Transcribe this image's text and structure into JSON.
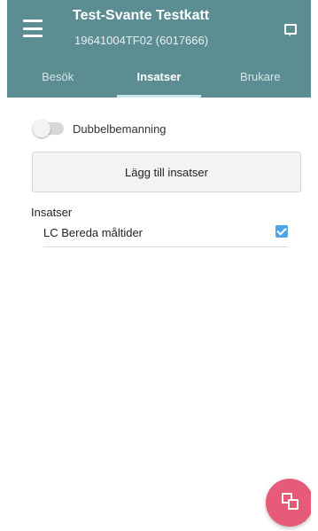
{
  "header": {
    "title": "Test-Svante Testkatt",
    "subtitle": "19641004TF02 (6017666)",
    "menu_icon": "menu-icon",
    "chat_icon": "chat-icon",
    "accent_color": "#5b8d93"
  },
  "tabs": [
    {
      "label": "Besök",
      "active": false
    },
    {
      "label": "Insatser",
      "active": true
    },
    {
      "label": "Brukare",
      "active": false
    }
  ],
  "toggle": {
    "label": "Dubbelbemanning",
    "checked": false
  },
  "add_button": {
    "label": "Lägg till insatser"
  },
  "section": {
    "heading": "Insatser",
    "items": [
      {
        "label": "LC Bereda måltider",
        "checked": true
      }
    ]
  },
  "fab": {
    "icon": "copy-icon",
    "color": "#e55b78"
  }
}
